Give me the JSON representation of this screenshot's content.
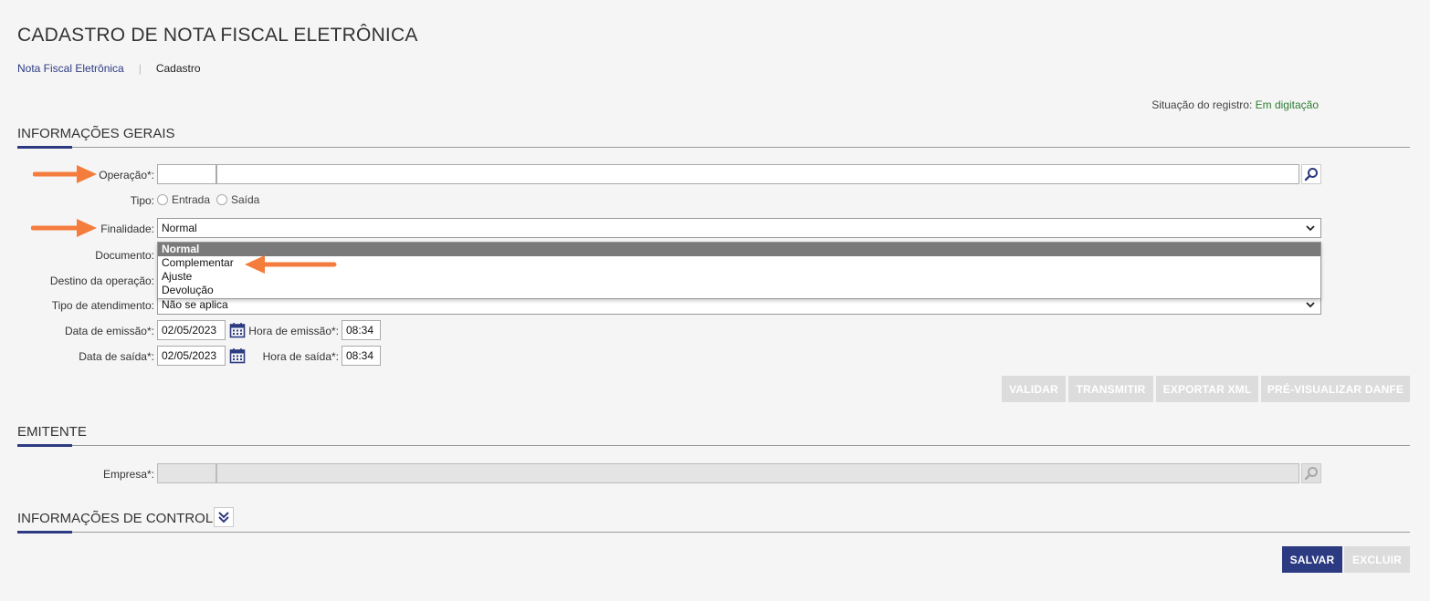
{
  "page": {
    "title": "CADASTRO DE NOTA FISCAL ELETRÔNICA",
    "breadcrumb": {
      "link": "Nota Fiscal Eletrônica",
      "separator": "|",
      "current": "Cadastro"
    },
    "status_label": "Situação do registro:",
    "status_value": "Em digitação"
  },
  "sections": {
    "general": "INFORMAÇÕES GERAIS",
    "issuer": "EMITENTE",
    "control": "INFORMAÇÕES DE CONTROLE"
  },
  "form": {
    "operacao_label": "Operação*:",
    "operacao_code": "",
    "operacao_desc": "",
    "tipo_label": "Tipo:",
    "tipo_options": [
      "Entrada",
      "Saída"
    ],
    "finalidade_label": "Finalidade:",
    "finalidade_value": "Normal",
    "finalidade_options": [
      "Normal",
      "Complementar",
      "Ajuste",
      "Devolução"
    ],
    "documento_label": "Documento:",
    "destino_label": "Destino da operação:",
    "tipo_atendimento_label": "Tipo de atendimento:",
    "tipo_atendimento_value": "Não se aplica",
    "data_emissao_label": "Data de emissão*:",
    "data_emissao_value": "02/05/2023",
    "hora_emissao_label": "Hora de emissão*:",
    "hora_emissao_value": "08:34",
    "data_saida_label": "Data de saída*:",
    "data_saida_value": "02/05/2023",
    "hora_saida_label": "Hora de saída*:",
    "hora_saida_value": "08:34",
    "empresa_label": "Empresa*:"
  },
  "actions": {
    "validar": "VALIDAR",
    "transmitir": "TRANSMITIR",
    "exportar_xml": "EXPORTAR XML",
    "pre_visualizar": "PRÉ-VISUALIZAR DANFE",
    "salvar": "SALVAR",
    "excluir": "EXCLUIR"
  },
  "colors": {
    "accent": "#2c3a82",
    "annotation_arrow": "#f47c3c",
    "status_ok": "#2e7d32",
    "disabled_button": "#dcdcdc"
  }
}
